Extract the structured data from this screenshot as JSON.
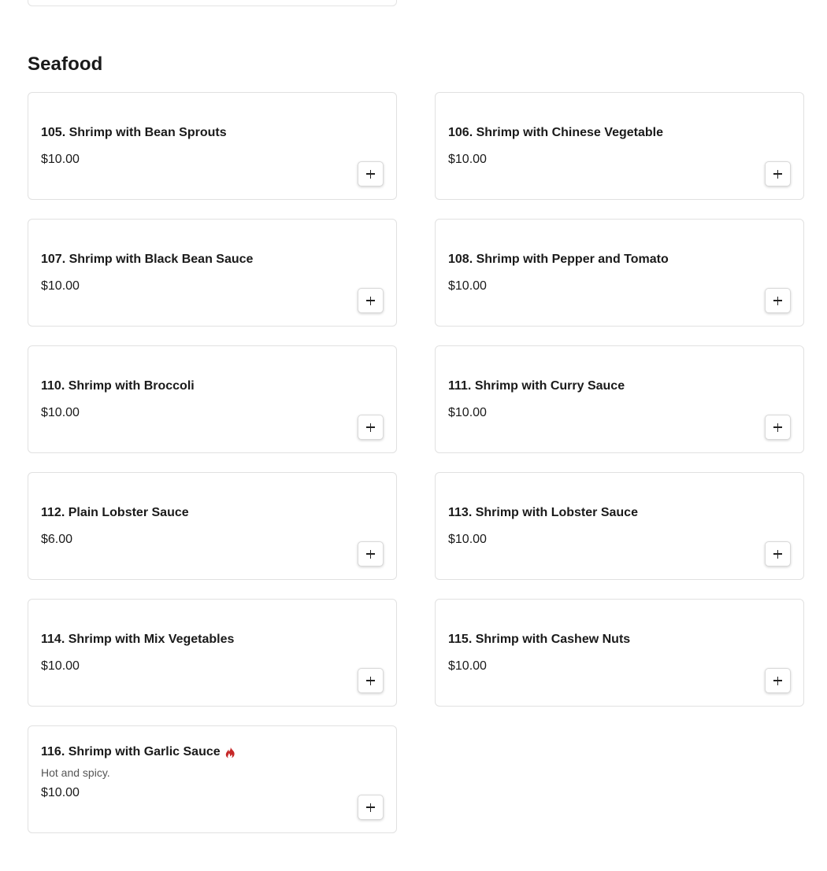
{
  "section": {
    "title": "Seafood"
  },
  "items": [
    {
      "name": "105. Shrimp with Bean Sprouts",
      "price": "$10.00",
      "description": "",
      "spicy": false
    },
    {
      "name": "106. Shrimp with Chinese Vegetable",
      "price": "$10.00",
      "description": "",
      "spicy": false
    },
    {
      "name": "107. Shrimp with Black Bean Sauce",
      "price": "$10.00",
      "description": "",
      "spicy": false
    },
    {
      "name": "108. Shrimp with Pepper and Tomato",
      "price": "$10.00",
      "description": "",
      "spicy": false
    },
    {
      "name": "110. Shrimp with Broccoli",
      "price": "$10.00",
      "description": "",
      "spicy": false
    },
    {
      "name": "111. Shrimp with Curry Sauce",
      "price": "$10.00",
      "description": "",
      "spicy": false
    },
    {
      "name": "112. Plain Lobster Sauce",
      "price": "$6.00",
      "description": "",
      "spicy": false
    },
    {
      "name": "113. Shrimp with Lobster Sauce",
      "price": "$10.00",
      "description": "",
      "spicy": false
    },
    {
      "name": "114. Shrimp with Mix Vegetables",
      "price": "$10.00",
      "description": "",
      "spicy": false
    },
    {
      "name": "115. Shrimp with Cashew Nuts",
      "price": "$10.00",
      "description": "",
      "spicy": false
    },
    {
      "name": "116. Shrimp with Garlic Sauce",
      "price": "$10.00",
      "description": "Hot and spicy.",
      "spicy": true
    }
  ],
  "icons": {
    "add": "plus-icon",
    "spicy": "flame-icon"
  },
  "colors": {
    "spicy": "#c62828",
    "border": "#e1e1e1",
    "text": "#1a1a1a"
  }
}
